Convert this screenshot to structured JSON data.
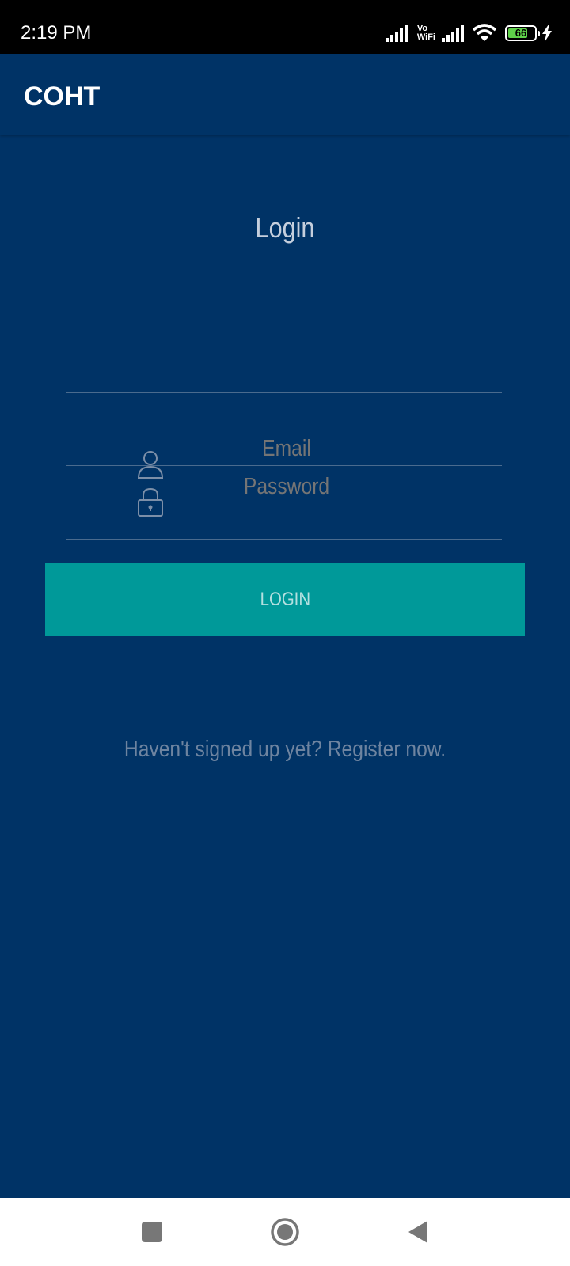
{
  "status_bar": {
    "time": "2:19 PM",
    "vowifi_top": "Vo",
    "vowifi_bottom": "WiFi",
    "battery_level": "66",
    "icons": [
      "signal-icon",
      "vowifi-icon",
      "signal-icon",
      "wifi-icon",
      "battery-icon",
      "charging-icon"
    ]
  },
  "app_bar": {
    "title": "COHT"
  },
  "login": {
    "heading": "Login",
    "email_placeholder": "Email",
    "password_placeholder": "Password",
    "button_label": "LOGIN",
    "register_text": "Haven't signed up yet? Register now."
  },
  "nav_bar": {
    "buttons": [
      "recents-square-icon",
      "home-circle-icon",
      "back-triangle-icon"
    ]
  },
  "colors": {
    "background": "#003366",
    "button": "#009999",
    "status_bar": "#000000",
    "nav_bar": "#ffffff"
  }
}
